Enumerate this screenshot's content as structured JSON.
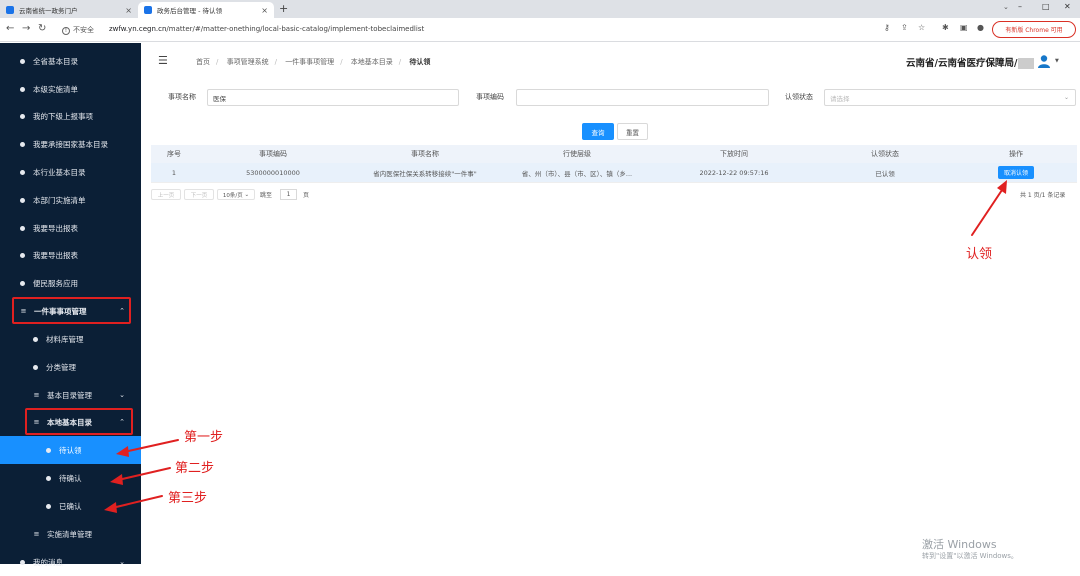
{
  "browser": {
    "tabs": [
      {
        "title": "云南省统一政务门户",
        "active": false
      },
      {
        "title": "政务后台管理 - 待认领",
        "active": true
      }
    ],
    "new_tab": "+",
    "secure_label": "不安全",
    "url_host": "zwfw.yn.cegn.cn",
    "url_path": "/matter/#/matter-onething/local-basic-catalog/implement-tobeclaimedlist",
    "update_label": "有新版 Chrome 可用"
  },
  "sidebar": {
    "items": [
      {
        "label": "全省基本目录",
        "kind": "dot"
      },
      {
        "label": "本级实施清单",
        "kind": "dot"
      },
      {
        "label": "我的下级上报事项",
        "kind": "dot"
      },
      {
        "label": "我要承接国家基本目录",
        "kind": "dot"
      },
      {
        "label": "本行业基本目录",
        "kind": "dot"
      },
      {
        "label": "本部门实施清单",
        "kind": "dot"
      },
      {
        "label": "我要导出报表",
        "kind": "dot"
      },
      {
        "label": "我要导出报表",
        "kind": "dot"
      },
      {
        "label": "便民服务应用",
        "kind": "dot"
      },
      {
        "label": "一件事事项管理",
        "kind": "menu",
        "chev": "^"
      },
      {
        "label": "材料库管理",
        "kind": "dot"
      },
      {
        "label": "分类管理",
        "kind": "dot"
      },
      {
        "label": "基本目录管理",
        "kind": "menu",
        "chev": "v"
      },
      {
        "label": "本地基本目录",
        "kind": "menu",
        "chev": "^"
      },
      {
        "label": "待认领",
        "kind": "dot",
        "active": true
      },
      {
        "label": "待确认",
        "kind": "dot"
      },
      {
        "label": "已确认",
        "kind": "dot"
      },
      {
        "label": "实施清单管理",
        "kind": "menu"
      },
      {
        "label": "我的消息",
        "kind": "dot",
        "chev": "v"
      }
    ]
  },
  "header": {
    "breadcrumb": [
      "首页",
      "事项管理系统",
      "一件事事项管理",
      "本地基本目录",
      "待认领"
    ],
    "org": "云南省/云南省医疗保障局/"
  },
  "search": {
    "name_label": "事项名称",
    "name_value": "医保",
    "code_label": "事项编码",
    "code_value": "",
    "status_label": "认领状态",
    "status_placeholder": "请选择",
    "query_button": "查询",
    "reset_button": "重置"
  },
  "table": {
    "columns": [
      "序号",
      "事项编码",
      "事项名称",
      "行使层级",
      "下放时间",
      "认领状态",
      "操作"
    ],
    "rows": [
      {
        "index": "1",
        "code": "5300000010000",
        "name": "省内医保社保关系转移接续\"一件事\"",
        "level": "省、州（市）、县（市、区）、镇（乡...",
        "time": "2022-12-22 09:57:16",
        "status": "已认领",
        "action": "取消认领"
      }
    ]
  },
  "pager": {
    "prev": "上一页",
    "next": "下一页",
    "page_size": "10条/页",
    "goto_label": "跳至",
    "goto_value": "1",
    "page_unit": "页",
    "total": "共 1 页/1 条记录"
  },
  "annotations": {
    "claim": "认领",
    "step1": "第一步",
    "step2": "第二步",
    "step3": "第三步"
  },
  "watermark": {
    "line1": "激活 Windows",
    "line2": "转到\"设置\"以激活 Windows。"
  },
  "colors": {
    "sidebar_bg": "#0b1f36",
    "accent": "#1890ff",
    "annotation_red": "#e02020"
  }
}
